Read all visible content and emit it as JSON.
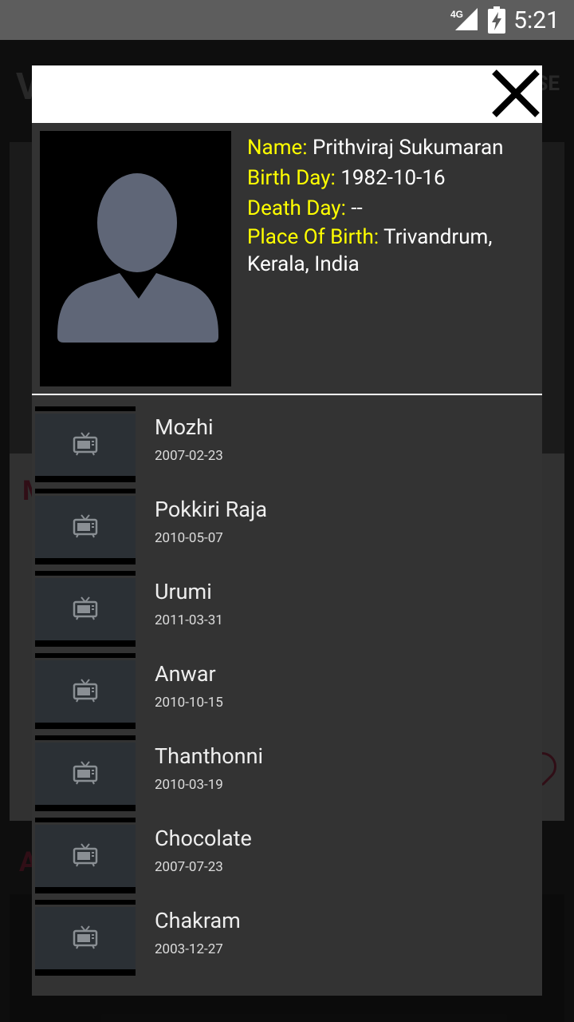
{
  "status_bar": {
    "time": "5:21",
    "network": "4G"
  },
  "background": {
    "title_letter": "V",
    "close_text": "SE",
    "section_letter": "M",
    "section2_letter": "A"
  },
  "person": {
    "labels": {
      "name": "Name:",
      "birth_day": "Birth Day:",
      "death_day": "Death Day:",
      "place_of_birth": "Place Of Birth:"
    },
    "name": "Prithviraj Sukumaran",
    "birth_day": "1982-10-16",
    "death_day": "--",
    "place_of_birth": "Trivandrum, Kerala, India"
  },
  "movies": [
    {
      "title": "Mozhi",
      "date": "2007-02-23"
    },
    {
      "title": "Pokkiri Raja",
      "date": "2010-05-07"
    },
    {
      "title": "Urumi",
      "date": "2011-03-31"
    },
    {
      "title": "Anwar",
      "date": "2010-10-15"
    },
    {
      "title": "Thanthonni",
      "date": "2010-03-19"
    },
    {
      "title": "Chocolate",
      "date": "2007-07-23"
    },
    {
      "title": "Chakram",
      "date": "2003-12-27"
    }
  ],
  "colors": {
    "label": "#ffff00",
    "dialog_bg": "#333333",
    "header_bg": "#ffffff"
  }
}
